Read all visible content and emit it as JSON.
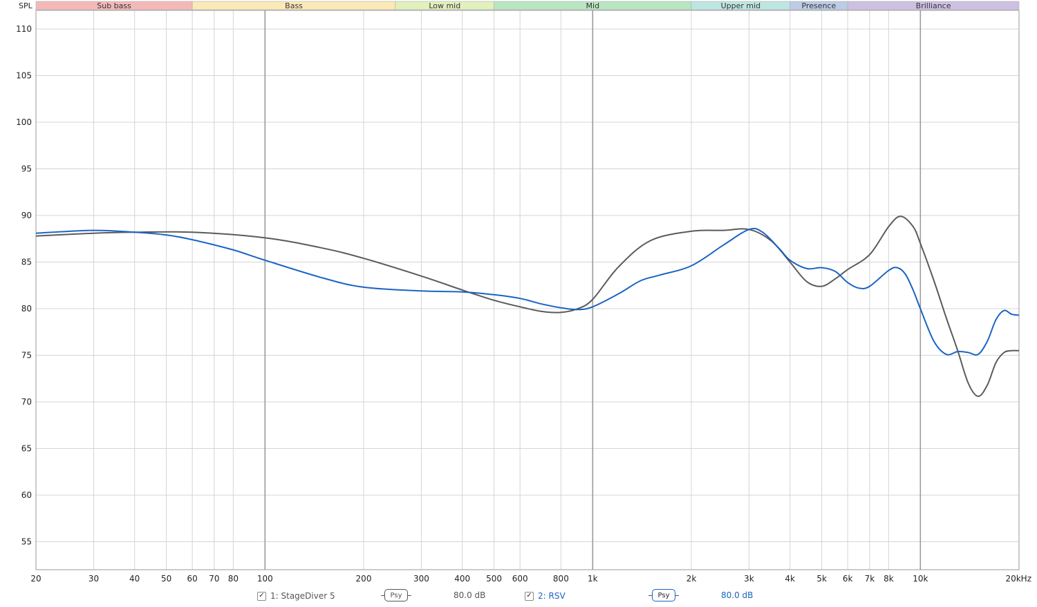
{
  "chart_data": {
    "type": "line",
    "ylabel": "SPL",
    "x_scale": "log",
    "xlim": [
      20,
      20000
    ],
    "ylim": [
      52,
      112
    ],
    "y_ticks": [
      55,
      60,
      65,
      70,
      75,
      80,
      85,
      90,
      95,
      100,
      105,
      110
    ],
    "x_ticks": [
      {
        "value": 20,
        "label": "20"
      },
      {
        "value": 30,
        "label": "30"
      },
      {
        "value": 40,
        "label": "40"
      },
      {
        "value": 50,
        "label": "50"
      },
      {
        "value": 60,
        "label": "60"
      },
      {
        "value": 70,
        "label": "70"
      },
      {
        "value": 80,
        "label": "80"
      },
      {
        "value": 100,
        "label": "100"
      },
      {
        "value": 200,
        "label": "200"
      },
      {
        "value": 300,
        "label": "300"
      },
      {
        "value": 400,
        "label": "400"
      },
      {
        "value": 500,
        "label": "500"
      },
      {
        "value": 600,
        "label": "600"
      },
      {
        "value": 800,
        "label": "800"
      },
      {
        "value": 1000,
        "label": "1k"
      },
      {
        "value": 2000,
        "label": "2k"
      },
      {
        "value": 3000,
        "label": "3k"
      },
      {
        "value": 4000,
        "label": "4k"
      },
      {
        "value": 5000,
        "label": "5k"
      },
      {
        "value": 6000,
        "label": "6k"
      },
      {
        "value": 7000,
        "label": "7k"
      },
      {
        "value": 8000,
        "label": "8k"
      },
      {
        "value": 10000,
        "label": "10k"
      },
      {
        "value": 20000,
        "label": "20kHz"
      }
    ],
    "bands": [
      {
        "label": "Sub bass",
        "from": 20,
        "to": 60,
        "color": "#f5b8b8"
      },
      {
        "label": "Bass",
        "from": 60,
        "to": 250,
        "color": "#fbe9b8"
      },
      {
        "label": "Low mid",
        "from": 250,
        "to": 500,
        "color": "#e2f0bb"
      },
      {
        "label": "Mid",
        "from": 500,
        "to": 2000,
        "color": "#b9e5c2"
      },
      {
        "label": "Upper mid",
        "from": 2000,
        "to": 4000,
        "color": "#bde6e2"
      },
      {
        "label": "Presence",
        "from": 4000,
        "to": 6000,
        "color": "#bccbe6"
      },
      {
        "label": "Brilliance",
        "from": 6000,
        "to": 20000,
        "color": "#cdc0e2"
      }
    ],
    "series": [
      {
        "name": "1: StageDiver 5",
        "color": "#5a5a5a",
        "points": [
          [
            20,
            87.8
          ],
          [
            30,
            88.1
          ],
          [
            40,
            88.2
          ],
          [
            60,
            88.2
          ],
          [
            100,
            87.6
          ],
          [
            150,
            86.5
          ],
          [
            200,
            85.4
          ],
          [
            300,
            83.5
          ],
          [
            400,
            82.0
          ],
          [
            500,
            80.9
          ],
          [
            600,
            80.2
          ],
          [
            700,
            79.7
          ],
          [
            800,
            79.6
          ],
          [
            900,
            80.0
          ],
          [
            1000,
            81.0
          ],
          [
            1200,
            84.5
          ],
          [
            1500,
            87.3
          ],
          [
            2000,
            88.3
          ],
          [
            2500,
            88.4
          ],
          [
            3000,
            88.5
          ],
          [
            3500,
            87.3
          ],
          [
            4000,
            85.0
          ],
          [
            4500,
            82.9
          ],
          [
            5000,
            82.4
          ],
          [
            5500,
            83.2
          ],
          [
            6000,
            84.2
          ],
          [
            7000,
            85.8
          ],
          [
            8000,
            88.8
          ],
          [
            8700,
            89.9
          ],
          [
            9500,
            88.8
          ],
          [
            10000,
            87.0
          ],
          [
            11000,
            83.0
          ],
          [
            12000,
            79.0
          ],
          [
            13000,
            75.5
          ],
          [
            14000,
            72.0
          ],
          [
            15000,
            70.6
          ],
          [
            16000,
            71.8
          ],
          [
            17000,
            74.2
          ],
          [
            18000,
            75.3
          ],
          [
            19000,
            75.5
          ],
          [
            20000,
            75.5
          ]
        ]
      },
      {
        "name": "2: RSV",
        "color": "#1a63c4",
        "points": [
          [
            20,
            88.1
          ],
          [
            30,
            88.4
          ],
          [
            40,
            88.2
          ],
          [
            50,
            87.9
          ],
          [
            60,
            87.4
          ],
          [
            80,
            86.3
          ],
          [
            100,
            85.2
          ],
          [
            150,
            83.3
          ],
          [
            200,
            82.3
          ],
          [
            300,
            81.9
          ],
          [
            400,
            81.8
          ],
          [
            500,
            81.5
          ],
          [
            600,
            81.1
          ],
          [
            700,
            80.5
          ],
          [
            800,
            80.1
          ],
          [
            900,
            79.9
          ],
          [
            1000,
            80.2
          ],
          [
            1200,
            81.6
          ],
          [
            1400,
            83.0
          ],
          [
            1600,
            83.6
          ],
          [
            2000,
            84.6
          ],
          [
            2500,
            86.8
          ],
          [
            3000,
            88.5
          ],
          [
            3300,
            88.2
          ],
          [
            3700,
            86.5
          ],
          [
            4000,
            85.2
          ],
          [
            4500,
            84.3
          ],
          [
            5000,
            84.4
          ],
          [
            5500,
            84.0
          ],
          [
            6000,
            82.8
          ],
          [
            6500,
            82.2
          ],
          [
            7000,
            82.4
          ],
          [
            8000,
            84.1
          ],
          [
            8500,
            84.4
          ],
          [
            9000,
            83.7
          ],
          [
            9500,
            82.0
          ],
          [
            10000,
            80.0
          ],
          [
            11000,
            76.5
          ],
          [
            12000,
            75.1
          ],
          [
            13000,
            75.4
          ],
          [
            14000,
            75.3
          ],
          [
            15000,
            75.1
          ],
          [
            16000,
            76.5
          ],
          [
            17000,
            78.8
          ],
          [
            18000,
            79.8
          ],
          [
            19000,
            79.4
          ],
          [
            20000,
            79.3
          ]
        ]
      }
    ]
  },
  "legend": [
    {
      "checked_glyph": "✓",
      "label": "1: StageDiver 5",
      "psy": "Psy",
      "level": "80.0 dB",
      "text_color": "#555555",
      "psy_color": "#555555"
    },
    {
      "checked_glyph": "✓",
      "label": "2: RSV",
      "psy": "Psy",
      "level": "80.0 dB",
      "text_color": "#1a63c4",
      "psy_color": "#1a63c4"
    }
  ]
}
